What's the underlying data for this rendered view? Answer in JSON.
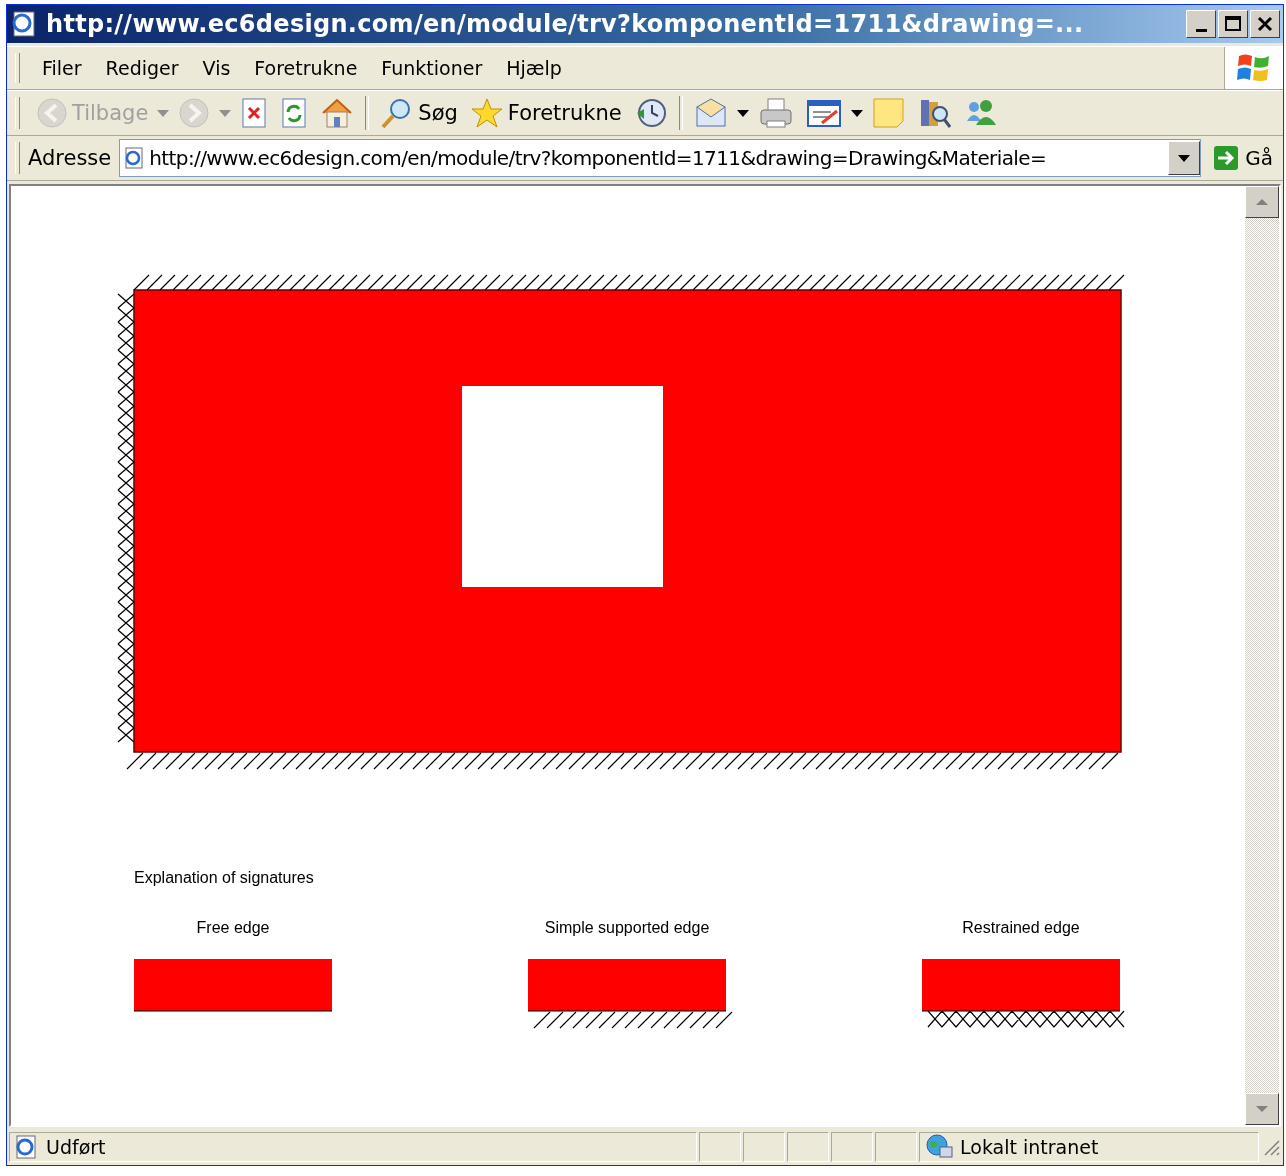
{
  "window": {
    "title": "http://www.ec6design.com/en/module/trv?komponentId=1711&drawing=..."
  },
  "menu": [
    {
      "label": "Filer"
    },
    {
      "label": "Rediger"
    },
    {
      "label": "Vis"
    },
    {
      "label": "Foretrukne"
    },
    {
      "label": "Funktioner"
    },
    {
      "label": "Hjælp"
    }
  ],
  "toolbar": [
    {
      "kind": "back",
      "label": "Tilbage",
      "disabled": true,
      "dropdown": true
    },
    {
      "kind": "forward",
      "disabled": true,
      "dropdown": true
    },
    {
      "kind": "stop",
      "disabled": false
    },
    {
      "kind": "refresh",
      "disabled": false
    },
    {
      "kind": "home",
      "disabled": false
    },
    {
      "kind": "separator"
    },
    {
      "kind": "search",
      "label": "Søg",
      "disabled": false
    },
    {
      "kind": "favorites",
      "label": "Foretrukne",
      "disabled": false
    },
    {
      "kind": "history",
      "disabled": false
    },
    {
      "kind": "separator"
    },
    {
      "kind": "mail",
      "disabled": false,
      "dropdown": true
    },
    {
      "kind": "print",
      "disabled": false
    },
    {
      "kind": "edit",
      "disabled": false,
      "dropdown": true
    },
    {
      "kind": "note",
      "disabled": false
    },
    {
      "kind": "research",
      "disabled": false
    },
    {
      "kind": "messenger",
      "disabled": false
    }
  ],
  "address_bar": {
    "label": "Adresse",
    "url": "http://www.ec6design.com/en/module/trv?komponentId=1711&drawing=Drawing&Materiale=",
    "go": "Gå"
  },
  "drawing": {
    "edges": [
      {
        "kind": "supported"
      },
      {
        "kind": "free"
      },
      {
        "kind": "supported"
      },
      {
        "kind": "restrained"
      }
    ],
    "legend": {
      "title": "Explanation of signatures",
      "items": [
        {
          "label": "Free edge",
          "kind": "free"
        },
        {
          "label": "Simple supported edge",
          "kind": "supported"
        },
        {
          "label": "Restrained edge",
          "kind": "restrained"
        }
      ]
    }
  },
  "status_bar": {
    "status": "Udført",
    "zone": "Lokalt intranet"
  }
}
